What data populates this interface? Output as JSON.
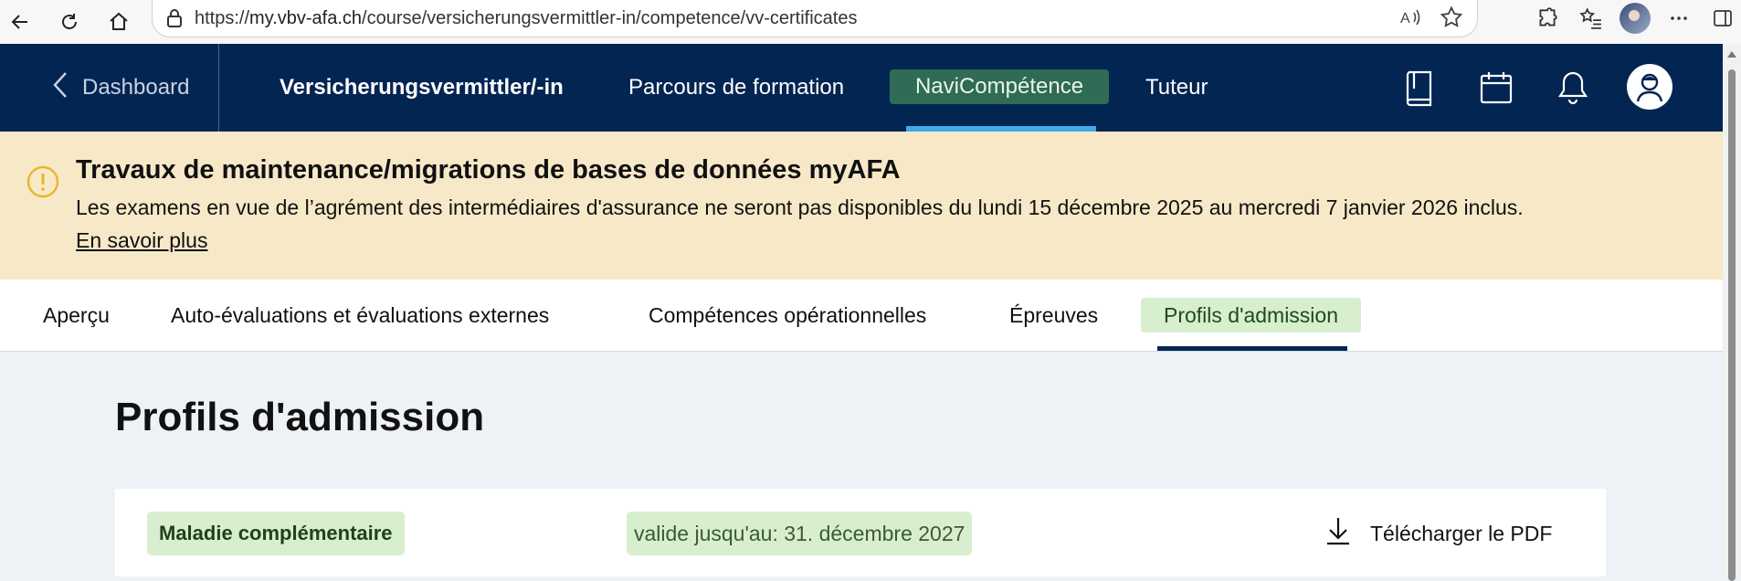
{
  "browser": {
    "url_scheme": "https://",
    "url_host": "my.vbv-afa.ch",
    "url_path": "/course/versicherungsvermittler-in/competence/vv-certificates"
  },
  "header": {
    "back_label": "Dashboard",
    "course_title": "Versicherungsvermittler/-in",
    "nav": [
      {
        "label": "Parcours de formation"
      },
      {
        "label": "NaviCompétence"
      },
      {
        "label": "Tuteur"
      }
    ]
  },
  "banner": {
    "title": "Travaux de maintenance/migrations de bases de données myAFA",
    "message": "Les examens en vue de l’agrément des intermédiaires d'assurance ne seront pas disponibles du lundi 15 décembre 2025 au mercredi 7 janvier 2026 inclus.",
    "link": "En savoir plus"
  },
  "tabs": [
    {
      "label": "Aperçu"
    },
    {
      "label": "Auto-évaluations et évaluations externes"
    },
    {
      "label": "Compétences opérationnelles"
    },
    {
      "label": "Épreuves"
    },
    {
      "label": "Profils d'admission"
    }
  ],
  "main": {
    "title": "Profils d'admission",
    "profiles": [
      {
        "name": "Maladie complémentaire",
        "validity": "valide jusqu'au: 31. décembre 2027",
        "download_label": "Télécharger le PDF"
      }
    ]
  },
  "colors": {
    "header_bg": "#032552",
    "active_nav_bg": "#2f6b55",
    "active_nav_underline": "#42a9e8",
    "banner_bg": "#f7e8c8",
    "warning_icon": "#e9b62a",
    "tag_bg": "#d7eecf"
  }
}
